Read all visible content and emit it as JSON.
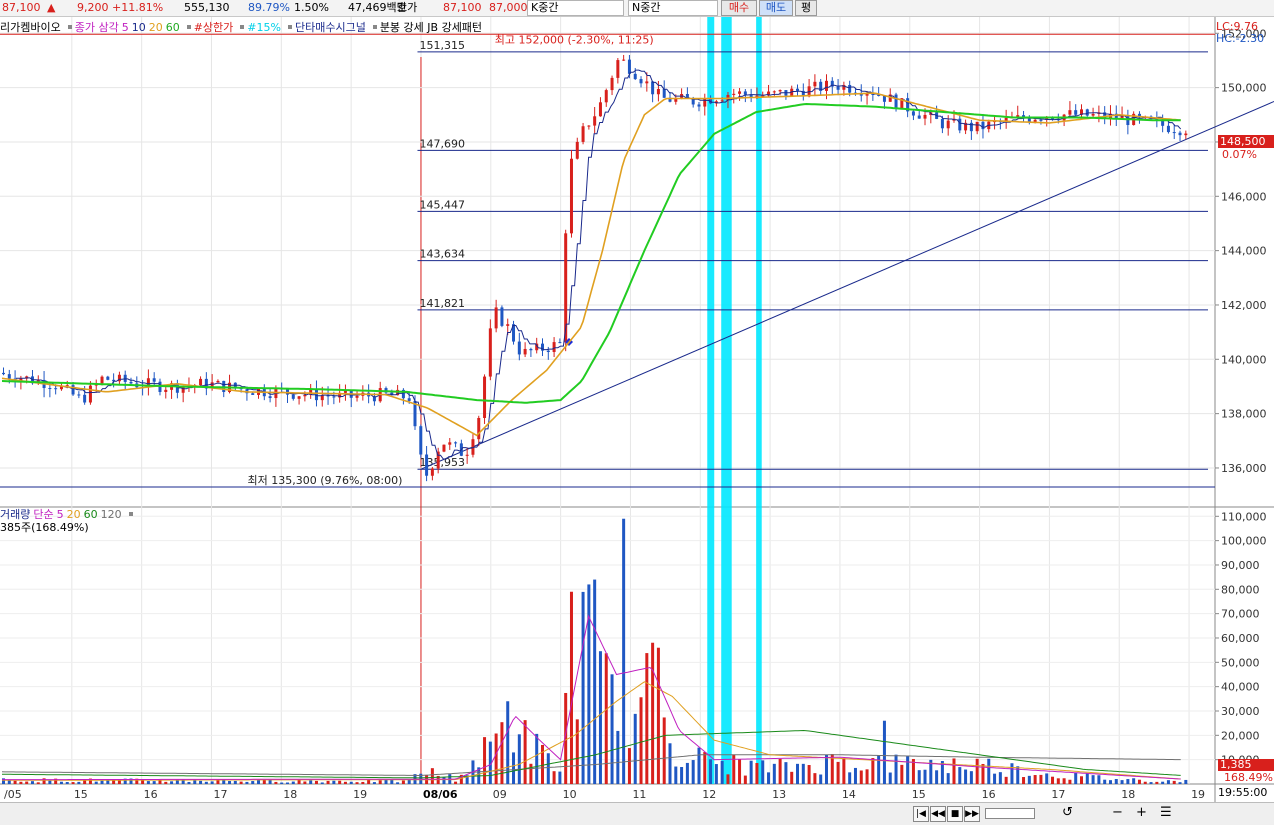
{
  "topbar": {
    "price": "87,100",
    "change_arrow": "▲",
    "change": "9,200",
    "change_pct": "+11.81%",
    "volume": "555,130",
    "vol_ratio": "89.79%",
    "ratio2": "1.50%",
    "amount": "47,469백만",
    "hoga_label": "호가",
    "hoga_ask": "87,100",
    "hoga_bid": "87,000",
    "k_label": "K중간",
    "n_label": "N중간",
    "buy_label": "매수",
    "sell_label": "매도",
    "avg_label": "평"
  },
  "legend_price": {
    "name": "리가켐바이오",
    "close_label": "종가 삼각",
    "ma5": "5",
    "ma10": "10",
    "ma20": "20",
    "ma60": "60",
    "upper": "#상한가",
    "pct15": "#15%",
    "signal": "단타매수시그널",
    "pattern": "분봉 강세 JB 강세패턴"
  },
  "legend_volume": {
    "name": "거래량",
    "simple": "단순",
    "ma5": "5",
    "ma20": "20",
    "ma60": "60",
    "ma120": "120",
    "current": "385주(168.49%)"
  },
  "right_info": {
    "lc": "LC:9.76",
    "hc": "HC:-2.30",
    "last_price": "148,500",
    "last_pct": "0.07%",
    "vol_last": "1,385",
    "vol_pct": "168.49%",
    "time": "19:55:00"
  },
  "annotations": {
    "high": "최고 152,000 (-2.30%, 11:25)",
    "low": "최저 135,300 (9.76%, 08:00)"
  },
  "colors": {
    "up": "#d8201c",
    "down": "#1f57c3",
    "ma5": "#1a2a8c",
    "ma20": "#e0a020",
    "ma60": "#22cc22",
    "highlight": "#00e8ff",
    "level": "#1a2a8c",
    "vol_ma5": "#c020c0",
    "vol_ma20": "#e0a020",
    "vol_ma60": "#1a8a1a",
    "vol_ma120": "#707070"
  },
  "chart_data": {
    "type": "candlestick",
    "price_axis": {
      "ticks": [
        136000,
        138000,
        140000,
        142000,
        144000,
        146000,
        148000,
        150000,
        152000
      ],
      "labels": [
        "136,000",
        "138,000",
        "140,000",
        "142,000",
        "144,000",
        "146,000",
        "148,000",
        "150,000",
        "152,000"
      ],
      "ylim": [
        134600,
        152600
      ]
    },
    "volume_axis": {
      "ticks": [
        10000,
        20000,
        30000,
        40000,
        50000,
        60000,
        70000,
        80000,
        90000,
        100000,
        110000
      ],
      "labels": [
        "10,000",
        "20,000",
        "30,000",
        "40,000",
        "50,000",
        "60,000",
        "70,000",
        "80,000",
        "90,000",
        "100,000",
        "110,000"
      ],
      "ylim": [
        0,
        113000
      ]
    },
    "x_labels": [
      "/05",
      "15",
      "16",
      "17",
      "18",
      "19",
      "08/06",
      "09",
      "10",
      "11",
      "12",
      "13",
      "14",
      "15",
      "16",
      "17",
      "18",
      "19"
    ],
    "levels": [
      {
        "label": "151,315",
        "value": 151315
      },
      {
        "label": "147,690",
        "value": 147690
      },
      {
        "label": "145,447",
        "value": 145447
      },
      {
        "label": "143,634",
        "value": 143634
      },
      {
        "label": "141,821",
        "value": 141821
      },
      {
        "label": "135,953",
        "value": 135953
      }
    ],
    "high_value": 152000,
    "low_value": 135300,
    "trendline": [
      [
        6.0,
        135953
      ],
      [
        19.85,
        151300
      ]
    ],
    "highlight_hours": [
      [
        10.1,
        10.2
      ],
      [
        10.3,
        10.45
      ],
      [
        10.8,
        10.88
      ]
    ],
    "price_anchors": [
      [
        0.0,
        139500
      ],
      [
        0.8,
        139100
      ],
      [
        1.2,
        138500
      ],
      [
        1.5,
        139300
      ],
      [
        2.0,
        139100
      ],
      [
        2.5,
        139000
      ],
      [
        3.0,
        139100
      ],
      [
        3.5,
        138900
      ],
      [
        4.0,
        138800
      ],
      [
        4.5,
        138700
      ],
      [
        5.0,
        138600
      ],
      [
        5.5,
        138700
      ],
      [
        5.9,
        138600
      ],
      [
        6.02,
        136600
      ],
      [
        6.15,
        135700
      ],
      [
        6.35,
        137000
      ],
      [
        6.7,
        136500
      ],
      [
        6.9,
        138000
      ],
      [
        7.1,
        141800
      ],
      [
        7.3,
        141200
      ],
      [
        7.5,
        140200
      ],
      [
        7.8,
        140400
      ],
      [
        8.1,
        140600
      ],
      [
        8.15,
        146800
      ],
      [
        8.4,
        148500
      ],
      [
        8.6,
        149200
      ],
      [
        8.9,
        151100
      ],
      [
        9.2,
        150400
      ],
      [
        9.5,
        149600
      ],
      [
        10.0,
        149500
      ],
      [
        10.5,
        149800
      ],
      [
        11.0,
        149700
      ],
      [
        11.5,
        149900
      ],
      [
        12.0,
        150100
      ],
      [
        12.5,
        149900
      ],
      [
        13.0,
        149300
      ],
      [
        13.5,
        148700
      ],
      [
        14.0,
        148500
      ],
      [
        14.5,
        148800
      ],
      [
        15.0,
        149000
      ],
      [
        15.5,
        149000
      ],
      [
        16.0,
        148900
      ],
      [
        16.5,
        148700
      ],
      [
        16.9,
        148500
      ]
    ],
    "ma20_anchors": [
      [
        0.0,
        139300
      ],
      [
        1.5,
        138800
      ],
      [
        2.5,
        139100
      ],
      [
        3.5,
        138800
      ],
      [
        5.5,
        138700
      ],
      [
        6.1,
        138200
      ],
      [
        6.8,
        137200
      ],
      [
        7.3,
        138500
      ],
      [
        7.8,
        139600
      ],
      [
        8.3,
        141200
      ],
      [
        8.6,
        144000
      ],
      [
        8.9,
        147300
      ],
      [
        9.2,
        149000
      ],
      [
        9.5,
        149600
      ],
      [
        10.3,
        149600
      ],
      [
        11.5,
        149700
      ],
      [
        12.5,
        149800
      ],
      [
        14.0,
        148800
      ],
      [
        15.0,
        148700
      ],
      [
        16.0,
        149000
      ],
      [
        16.9,
        148800
      ]
    ],
    "ma60_anchors": [
      [
        0.0,
        139200
      ],
      [
        2.5,
        139000
      ],
      [
        4.5,
        138900
      ],
      [
        5.8,
        138800
      ],
      [
        6.8,
        138500
      ],
      [
        7.5,
        138400
      ],
      [
        8.0,
        138500
      ],
      [
        8.3,
        139200
      ],
      [
        8.7,
        141000
      ],
      [
        9.2,
        144000
      ],
      [
        9.7,
        146800
      ],
      [
        10.2,
        148300
      ],
      [
        10.8,
        149100
      ],
      [
        11.5,
        149400
      ],
      [
        12.5,
        149300
      ],
      [
        13.5,
        149100
      ],
      [
        14.5,
        148900
      ],
      [
        15.5,
        148900
      ],
      [
        16.5,
        148800
      ],
      [
        16.9,
        148800
      ]
    ],
    "volume_anchors": [
      [
        0.0,
        2000
      ],
      [
        5.8,
        1500
      ],
      [
        6.0,
        7000
      ],
      [
        6.5,
        2500
      ],
      [
        7.0,
        20000
      ],
      [
        7.2,
        32000
      ],
      [
        7.5,
        22000
      ],
      [
        7.8,
        12000
      ],
      [
        8.0,
        6000
      ],
      [
        8.1,
        76000
      ],
      [
        8.3,
        70000
      ],
      [
        8.5,
        45000
      ],
      [
        8.8,
        60000
      ],
      [
        9.0,
        30000
      ],
      [
        9.3,
        50000
      ],
      [
        9.6,
        20000
      ],
      [
        10.0,
        12000
      ],
      [
        11.0,
        8000
      ],
      [
        12.0,
        12000
      ],
      [
        13.0,
        10000
      ],
      [
        14.0,
        10000
      ],
      [
        15.0,
        5000
      ],
      [
        16.0,
        2500
      ],
      [
        16.9,
        1400
      ]
    ],
    "volume_spikes": [
      [
        8.12,
        79000
      ],
      [
        8.37,
        82000
      ],
      [
        8.5,
        84000
      ],
      [
        8.88,
        109000
      ],
      [
        9.35,
        56000
      ],
      [
        7.2,
        34000
      ],
      [
        12.65,
        26000
      ]
    ],
    "vol_ma5_anchors": [
      [
        0.0,
        1800
      ],
      [
        6.5,
        2000
      ],
      [
        7.0,
        8000
      ],
      [
        7.35,
        28000
      ],
      [
        7.7,
        18000
      ],
      [
        8.0,
        10000
      ],
      [
        8.4,
        69000
      ],
      [
        8.8,
        45000
      ],
      [
        9.3,
        48000
      ],
      [
        9.7,
        22000
      ],
      [
        10.2,
        10000
      ],
      [
        12.0,
        11000
      ],
      [
        14.0,
        7000
      ],
      [
        16.9,
        2000
      ]
    ],
    "vol_ma20_anchors": [
      [
        0.0,
        1500
      ],
      [
        6.5,
        1800
      ],
      [
        7.4,
        8000
      ],
      [
        8.2,
        20000
      ],
      [
        8.8,
        34000
      ],
      [
        9.2,
        42000
      ],
      [
        9.6,
        36000
      ],
      [
        10.2,
        18000
      ],
      [
        11.0,
        12000
      ],
      [
        13.0,
        9000
      ],
      [
        15.0,
        6000
      ],
      [
        16.9,
        2000
      ]
    ],
    "vol_ma60_anchors": [
      [
        0.0,
        4000
      ],
      [
        6.0,
        2500
      ],
      [
        7.0,
        3500
      ],
      [
        8.5,
        12000
      ],
      [
        9.5,
        20000
      ],
      [
        11.5,
        22000
      ],
      [
        13.5,
        14000
      ],
      [
        15.5,
        6000
      ],
      [
        16.9,
        3500
      ]
    ],
    "vol_ma120_anchors": [
      [
        0.0,
        5000
      ],
      [
        6.0,
        3500
      ],
      [
        8.5,
        8000
      ],
      [
        10.0,
        12000
      ],
      [
        12.0,
        12000
      ],
      [
        14.0,
        11000
      ],
      [
        16.9,
        10000
      ]
    ]
  }
}
